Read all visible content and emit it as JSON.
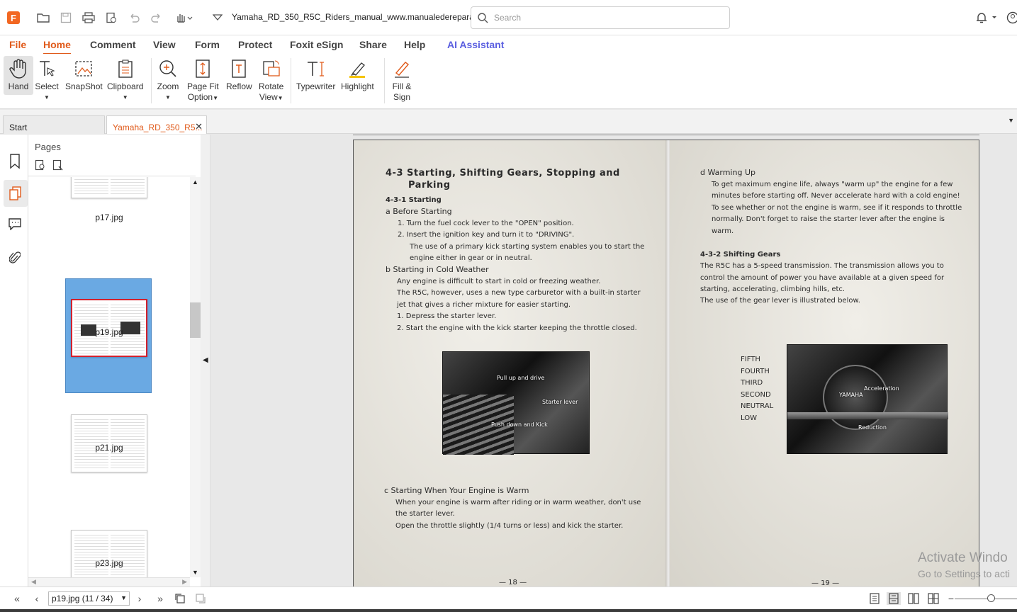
{
  "app": {
    "document_title": "Yamaha_RD_350_R5C_Riders_manual_www.manualedereparatie...",
    "search_placeholder": "Search"
  },
  "menu": [
    "File",
    "Home",
    "Comment",
    "View",
    "Form",
    "Protect",
    "Foxit eSign",
    "Share",
    "Help",
    "AI Assistant"
  ],
  "ribbon": {
    "hand": "Hand",
    "select": "Select",
    "snapshot": "SnapShot",
    "clipboard": "Clipboard",
    "zoom": "Zoom",
    "pagefit1": "Page Fit",
    "pagefit2": "Option",
    "reflow": "Reflow",
    "rotate1": "Rotate",
    "rotate2": "View",
    "typewriter": "Typewriter",
    "highlight": "Highlight",
    "fill1": "Fill &",
    "fill2": "Sign"
  },
  "tabs": {
    "start": "Start",
    "doc": "Yamaha_RD_350_R5..."
  },
  "pages_panel": {
    "title": "Pages",
    "thumbs": [
      "p17.jpg",
      "p19.jpg",
      "p21.jpg",
      "p23.jpg"
    ]
  },
  "doc": {
    "left": {
      "heading1": "4-3 Starting, Shifting Gears, Stopping and",
      "heading2": "Parking",
      "s431": "4-3-1  Starting",
      "a": "a   Before Starting",
      "a1": "1.   Turn the fuel cock lever to the \"OPEN\" position.",
      "a2": "2.   Insert the ignition key and turn it to \"DRIVING\".",
      "a3": "The use of a primary kick starting system enables you to start the",
      "a4": "engine either in gear or in neutral.",
      "b": "b   Starting in Cold Weather",
      "b1": "Any engine is difficult to start in cold or freezing weather.",
      "b2": "The R5C, however, uses a new type carburetor with a built-in starter",
      "b3": "jet that gives a richer mixture for easier starting.",
      "b4": "1.   Depress the starter lever.",
      "b5": "2.   Start the engine with the kick starter keeping the throttle closed.",
      "photo_l1": "Pull up and drive",
      "photo_l2": "Starter lever",
      "photo_l3": "Push down and Kick",
      "c": "c   Starting When Your Engine is Warm",
      "c1": "When your engine is warm after riding or in warm weather, don't use",
      "c2": "the starter lever.",
      "c3": "Open the throttle slightly (1/4 turns or less) and kick the starter.",
      "pageno": "— 18 —"
    },
    "right": {
      "d": "d   Warming Up",
      "d1": "To get maximum engine life, always \"warm up\" the engine for a few",
      "d2": "minutes before starting off.  Never accelerate hard with a cold engine!",
      "d3": "To see whether or not the engine is warm, see if it responds to throttle",
      "d4": "normally.  Don't forget to raise the starter lever after the engine is",
      "d5": "warm.",
      "s432": "4-3-2  Shifting Gears",
      "g1": "The R5C has a 5-speed transmission. The transmission allows you to",
      "g2": "control the amount of power you have available at a given speed for",
      "g3": "starting, accelerating, climbing hills, etc.",
      "g4": "The use of the gear lever is illustrated below.",
      "gears": [
        "FIFTH",
        "FOURTH",
        "THIRD",
        "SECOND",
        "NEUTRAL",
        "LOW"
      ],
      "photo_r1": "YAMAHA",
      "photo_r2": "Acceleration",
      "photo_r3": "Reduction",
      "pageno": "— 19 —"
    }
  },
  "watermark": {
    "line1": "Activate Windo",
    "line2": "Go to Settings to acti"
  },
  "status": {
    "page_field": "p19.jpg (11 / 34)"
  },
  "colors": {
    "accent": "#e05a1a",
    "ai": "#5a5ee0",
    "selection": "#6aa9e3"
  }
}
